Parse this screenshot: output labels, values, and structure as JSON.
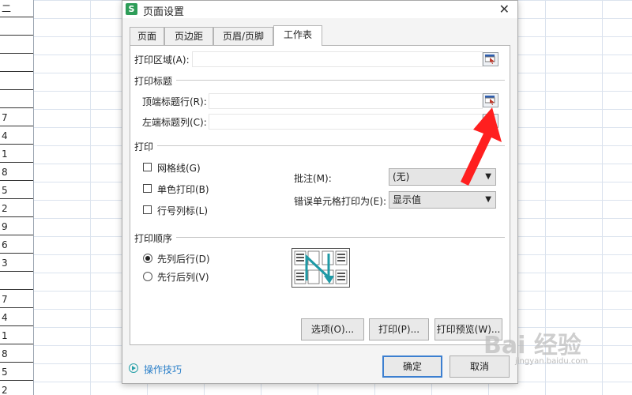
{
  "spreadsheet": {
    "column_a_cells": [
      "二",
      "",
      "",
      "",
      "",
      "",
      "7",
      "4",
      "1",
      "8",
      "5",
      "2",
      "9",
      "6",
      "3",
      "",
      "7",
      "4",
      "1",
      "8",
      "5",
      "2"
    ]
  },
  "dialog": {
    "title": "页面设置",
    "app_icon": "S",
    "close": "✕",
    "tabs": [
      {
        "label": "页面",
        "active": false
      },
      {
        "label": "页边距",
        "active": false
      },
      {
        "label": "页眉/页脚",
        "active": false
      },
      {
        "label": "工作表",
        "active": true
      }
    ],
    "print_area_label": "打印区域(A):",
    "print_titles_section": "打印标题",
    "top_rows_label": "顶端标题行(R):",
    "left_cols_label": "左端标题列(C):",
    "print_section": "打印",
    "checkboxes": [
      {
        "label": "网格线(G)",
        "checked": false
      },
      {
        "label": "单色打印(B)",
        "checked": false
      },
      {
        "label": "行号列标(L)",
        "checked": false
      }
    ],
    "comments_label": "批注(M):",
    "comments_value": "(无)",
    "errors_label": "错误单元格打印为(E):",
    "errors_value": "显示值",
    "order_section": "打印顺序",
    "radios": [
      {
        "label": "先列后行(D)",
        "selected": true
      },
      {
        "label": "先行后列(V)",
        "selected": false
      }
    ],
    "buttons": {
      "options": "选项(O)...",
      "print": "打印(P)...",
      "preview": "打印预览(W)...",
      "ok": "确定",
      "cancel": "取消"
    },
    "tips": "操作技巧"
  },
  "watermark": {
    "main": "Bai 经验",
    "sub": "jingyan.baidu.com"
  },
  "colors": {
    "accent": "#3c7fd0",
    "arrow": "#ff1f1f",
    "tip": "#2a7fc9",
    "teal": "#1f9aa6"
  }
}
